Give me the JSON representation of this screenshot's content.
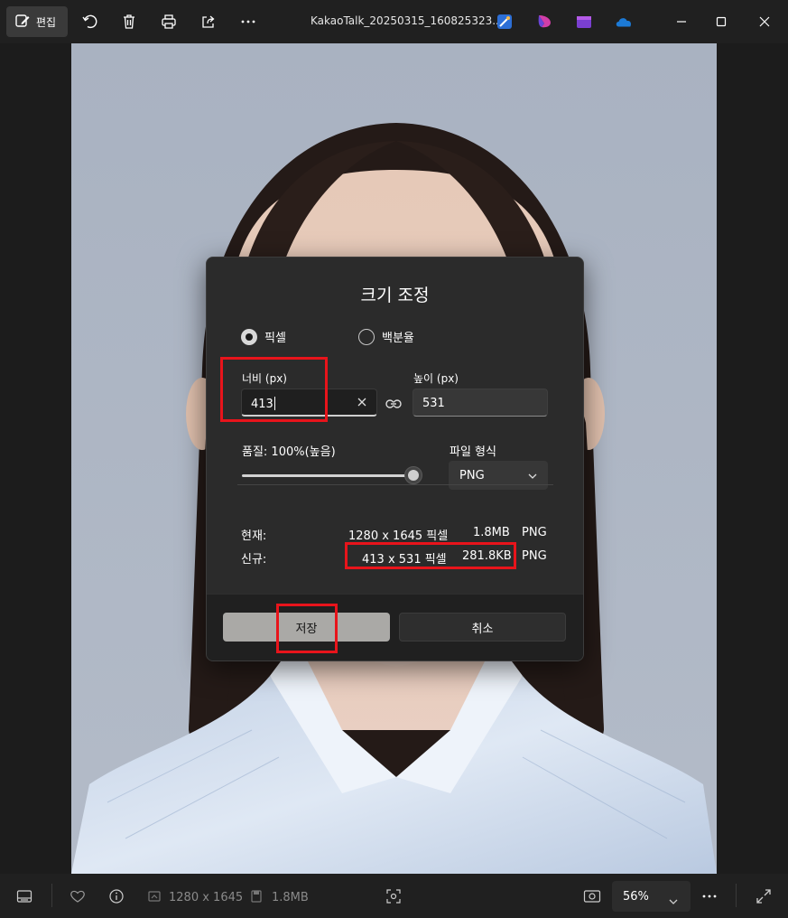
{
  "toolbar": {
    "edit_label": "편집",
    "file_name": "KakaoTalk_20250315_160825323..."
  },
  "dialog": {
    "title": "크기 조정",
    "mode_pixels": "픽셀",
    "mode_percent": "백분율",
    "width_label": "너비 (px)",
    "width_value": "413",
    "height_label": "높이 (px)",
    "height_value": "531",
    "quality_label": "품질: 100%(높음)",
    "quality_level_percent": 100,
    "format_label": "파일 형식",
    "format_value": "PNG",
    "current_label": "현재:",
    "current_dims": "1280 x 1645 픽셀",
    "current_size": "1.8MB",
    "current_format": "PNG",
    "new_label": "신규:",
    "new_dims": "413 x 531 픽셀",
    "new_size": "281.8KB",
    "new_format": "PNG",
    "save_label": "저장",
    "cancel_label": "취소"
  },
  "statusbar": {
    "dimensions": "1280 x 1645",
    "file_size": "1.8MB",
    "zoom": "56%"
  },
  "colors": {
    "highlight": "#e8141b",
    "save_button": "#aaa9a6",
    "dialog_bg": "#2b2b2b"
  }
}
